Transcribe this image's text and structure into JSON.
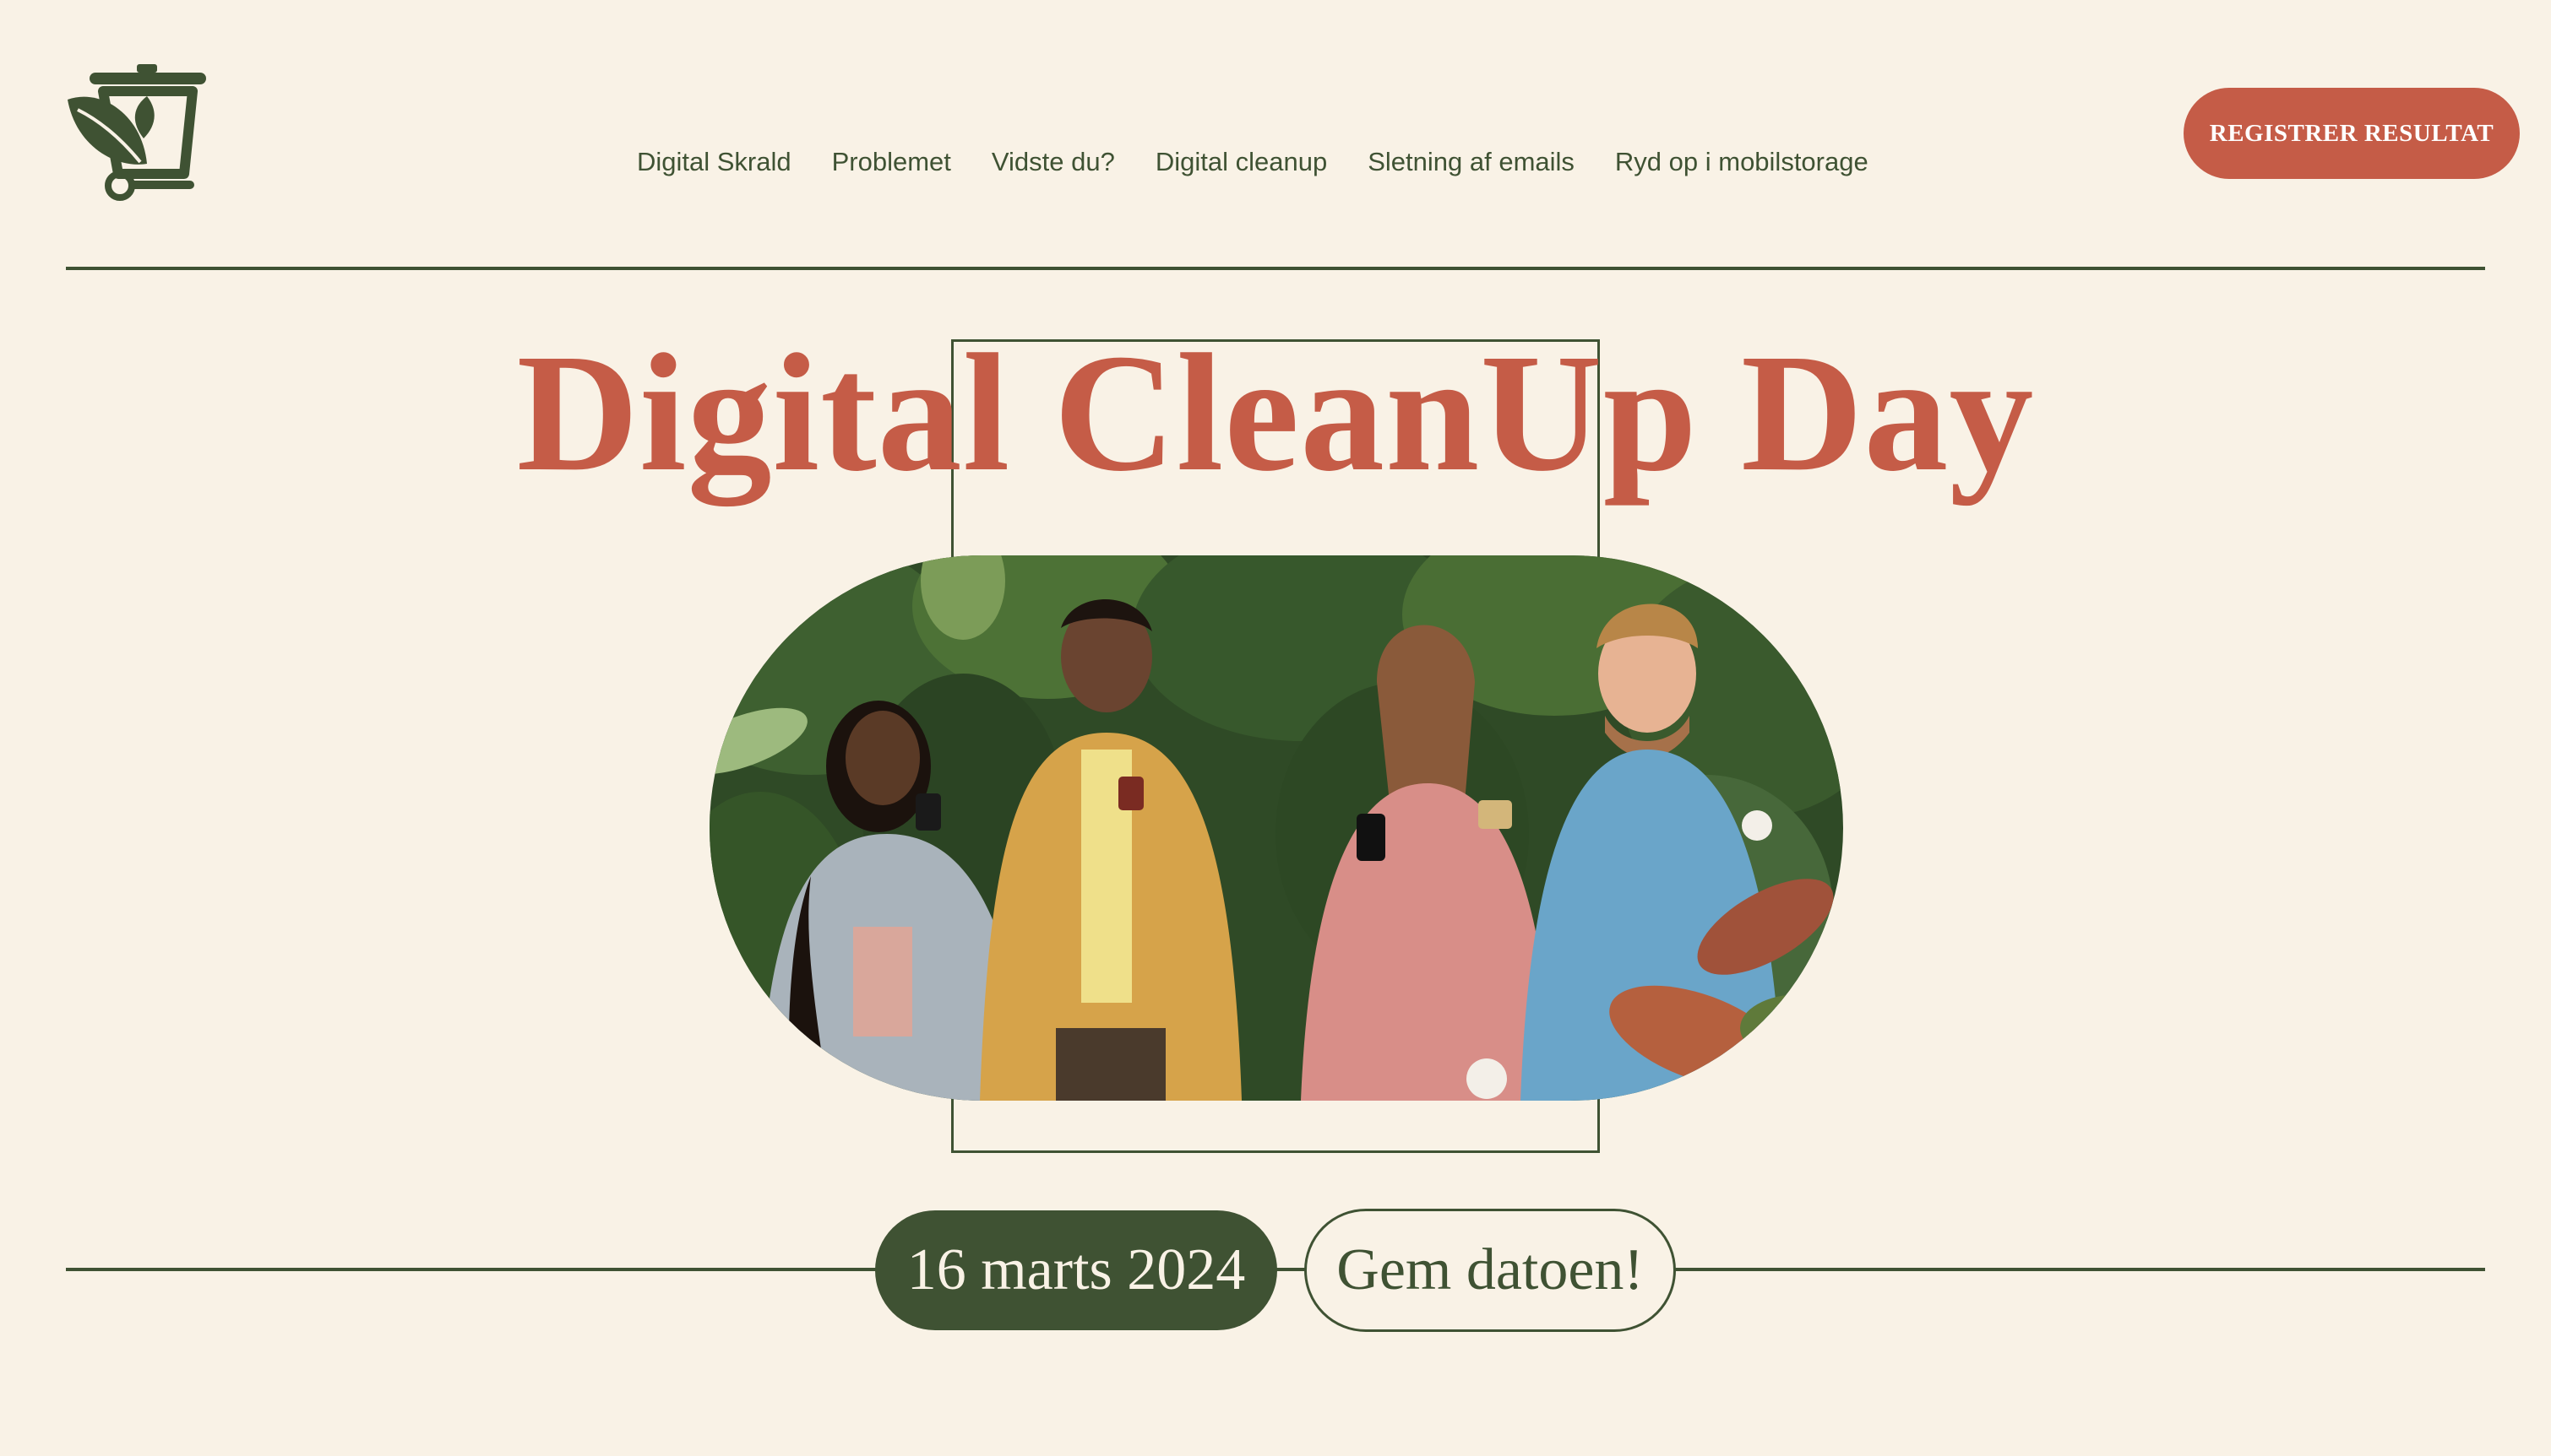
{
  "brand": {
    "logo_icon": "trash-bin-leaf-icon"
  },
  "nav": {
    "items": [
      {
        "label": "Digital Skrald"
      },
      {
        "label": "Problemet"
      },
      {
        "label": "Vidste du?"
      },
      {
        "label": "Digital cleanup"
      },
      {
        "label": "Sletning af emails"
      },
      {
        "label": "Ryd op i mobilstorage"
      }
    ]
  },
  "cta": {
    "label": "REGISTRER RESULTAT"
  },
  "hero": {
    "title": "Digital CleanUp Day",
    "image_description_icon": "people-using-phones-photo"
  },
  "event": {
    "date": "16 marts 2024",
    "save_label": "Gem datoen!"
  },
  "colors": {
    "background": "#f9f2e6",
    "primary_green": "#3f5233",
    "accent_red": "#c55c47"
  }
}
